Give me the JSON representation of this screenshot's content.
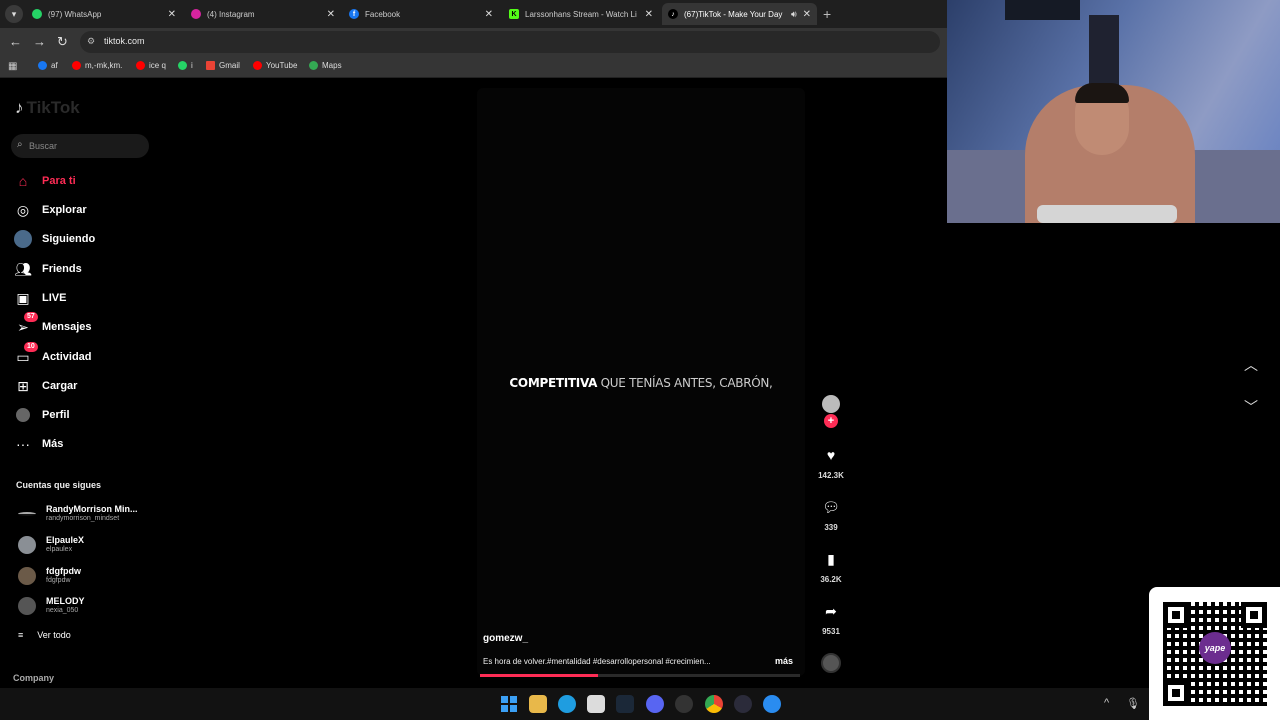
{
  "browser": {
    "tabs": [
      {
        "label": "(97) WhatsApp",
        "icon": "whatsapp-icon",
        "color": "#25d366"
      },
      {
        "label": "(4) Instagram",
        "icon": "instagram-icon",
        "color": "#d6249f"
      },
      {
        "label": "Facebook",
        "icon": "facebook-icon",
        "color": "#1877f2"
      },
      {
        "label": "Larssonhans Stream - Watch Li",
        "icon": "kick-icon",
        "color": "#53fc18"
      },
      {
        "label": "(67)TikTok - Make Your Day",
        "icon": "tiktok-icon",
        "color": "#000000"
      }
    ],
    "url": "tiktok.com",
    "bookmarks": [
      {
        "label": "af",
        "color": "#1877f2"
      },
      {
        "label": "m,-mk,km.",
        "color": "#ff0000"
      },
      {
        "label": "ice q",
        "color": "#ff0000"
      },
      {
        "label": "i",
        "color": "#25d366"
      },
      {
        "label": "Gmail",
        "color": "#ea4335"
      },
      {
        "label": "YouTube",
        "color": "#ff0000"
      },
      {
        "label": "Maps",
        "color": "#34a853"
      }
    ]
  },
  "tiktok": {
    "logo": "TikTok",
    "search_placeholder": "Buscar",
    "nav": [
      {
        "label": "Para ti",
        "icon": "home-icon"
      },
      {
        "label": "Explorar",
        "icon": "compass-icon"
      },
      {
        "label": "Siguiendo",
        "icon": "following-icon"
      },
      {
        "label": "Friends",
        "icon": "friends-icon"
      },
      {
        "label": "LIVE",
        "icon": "live-icon"
      },
      {
        "label": "Mensajes",
        "icon": "messages-icon",
        "badge": "57"
      },
      {
        "label": "Actividad",
        "icon": "activity-icon",
        "badge": "10"
      },
      {
        "label": "Cargar",
        "icon": "upload-icon"
      },
      {
        "label": "Perfil",
        "icon": "profile-icon"
      },
      {
        "label": "Más",
        "icon": "more-icon"
      }
    ],
    "followed_title": "Cuentas que sigues",
    "followed": [
      {
        "name": "RandyMorrison Min...",
        "user": "randymorrison_mindset"
      },
      {
        "name": "ElpauleX",
        "user": "elpaulex"
      },
      {
        "name": "fdgfpdw",
        "user": "fdgfpdw"
      },
      {
        "name": "MELODY",
        "user": "nexia_050"
      }
    ],
    "see_all": "Ver todo",
    "company": "Company",
    "video": {
      "caption_bold": "COMPETITIVA",
      "caption_rest": "QUE TENÍAS ANTES, CABRÓN,",
      "author": "gomezw_",
      "description": "Es hora de volver.#mentalidad #desarrollopersonal #crecimien...",
      "more": "más",
      "progress": 0.37
    },
    "actions": {
      "likes": "142.3K",
      "comments": "339",
      "saves": "36.2K",
      "shares": "9531"
    }
  },
  "overlay": {
    "qr_brand": "yape"
  }
}
